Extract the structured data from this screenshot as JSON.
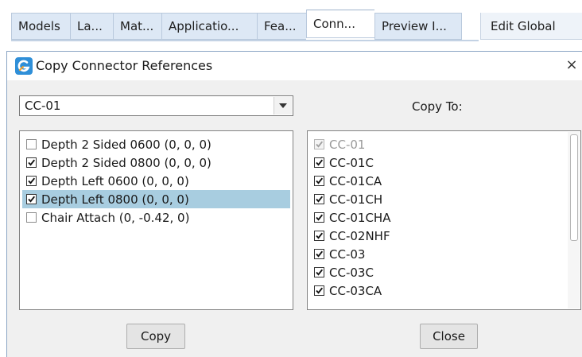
{
  "tabs": [
    {
      "label": "Models",
      "active": false
    },
    {
      "label": "La...",
      "active": false
    },
    {
      "label": "Mat...",
      "active": false
    },
    {
      "label": "Applicatio...",
      "active": false
    },
    {
      "label": "Fea...",
      "active": false
    },
    {
      "label": "Conn...",
      "active": true
    },
    {
      "label": "Preview I...",
      "active": false
    }
  ],
  "edit_global_label": "Edit Global",
  "dialog": {
    "title": "Copy Connector References",
    "close_glyph": "×",
    "source_select": {
      "value": "CC-01"
    },
    "copy_to_label": "Copy To:",
    "references": [
      {
        "label": "Depth 2 Sided 0600 (0, 0, 0)",
        "checked": false,
        "selected": false
      },
      {
        "label": "Depth 2 Sided 0800 (0, 0, 0)",
        "checked": true,
        "selected": false
      },
      {
        "label": "Depth Left 0600 (0, 0, 0)",
        "checked": true,
        "selected": false
      },
      {
        "label": "Depth Left 0800 (0, 0, 0)",
        "checked": true,
        "selected": true
      },
      {
        "label": "Chair Attach (0, -0.42, 0)",
        "checked": false,
        "selected": false
      }
    ],
    "targets": [
      {
        "label": "CC-01",
        "checked": true,
        "disabled": true
      },
      {
        "label": "CC-01C",
        "checked": true,
        "disabled": false
      },
      {
        "label": "CC-01CA",
        "checked": true,
        "disabled": false
      },
      {
        "label": "CC-01CH",
        "checked": true,
        "disabled": false
      },
      {
        "label": "CC-01CHA",
        "checked": true,
        "disabled": false
      },
      {
        "label": "CC-02NHF",
        "checked": true,
        "disabled": false
      },
      {
        "label": "CC-03",
        "checked": true,
        "disabled": false
      },
      {
        "label": "CC-03C",
        "checked": true,
        "disabled": false
      },
      {
        "label": "CC-03CA",
        "checked": true,
        "disabled": false
      }
    ],
    "copy_button": "Copy",
    "close_button": "Close"
  },
  "colors": {
    "selection": "#a8cde0",
    "tab_inactive": "#dde8f5",
    "dialog_background": "#f0f0f0",
    "app_icon": "#2f8fd8"
  },
  "icons": {
    "app": "app-logo-icon",
    "close": "close-icon",
    "dropdown": "chevron-down-icon",
    "check": "checkmark-icon"
  }
}
